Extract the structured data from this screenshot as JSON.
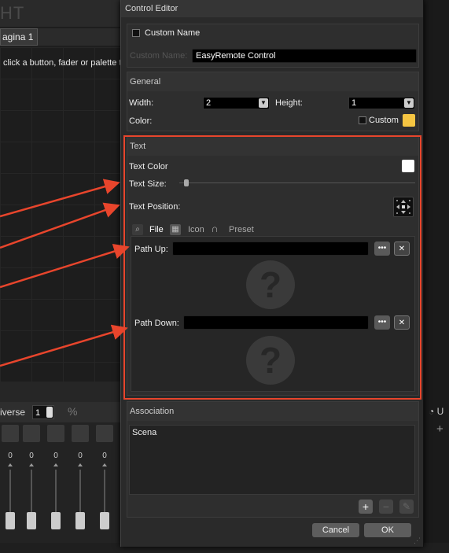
{
  "background": {
    "app_title_fragment": "HT",
    "page_tab": "agina 1",
    "hint_text": "click a button, fader or palette to",
    "universe_label": "iverse",
    "universe_value": "1",
    "fader_values": [
      "0",
      "0",
      "0",
      "0",
      "0",
      "0"
    ],
    "right_u_label": "U",
    "right_plus": "+"
  },
  "dialog": {
    "title": "Control Editor",
    "custom_name": {
      "checkbox_label": "Custom Name",
      "checked": false,
      "field_label": "Custom Name:",
      "field_value": "EasyRemote Control"
    },
    "general": {
      "header": "General",
      "width_label": "Width:",
      "width_value": "2",
      "height_label": "Height:",
      "height_value": "1",
      "color_label": "Color:",
      "custom_label": "Custom",
      "custom_checked": false,
      "custom_color": "#f5c542"
    },
    "text": {
      "header": "Text",
      "text_color_label": "Text Color",
      "text_color": "#ffffff",
      "text_size_label": "Text Size:",
      "text_position_label": "Text Position:",
      "tabs": [
        {
          "label": "File",
          "icon": "search-icon",
          "active": true
        },
        {
          "label": "Icon",
          "icon": "grid-icon",
          "active": false
        },
        {
          "label": "Preset",
          "icon": "magnet-icon",
          "active": false
        }
      ],
      "path_up_label": "Path Up:",
      "path_up_value": "",
      "path_down_label": "Path Down:",
      "path_down_value": "",
      "browse_glyph": "•••",
      "clear_glyph": "✕",
      "placeholder_glyph": "?"
    },
    "association": {
      "header": "Association",
      "items": [
        "Scena"
      ],
      "add_glyph": "+",
      "remove_glyph": "−",
      "edit_glyph": "✎"
    },
    "buttons": {
      "cancel": "Cancel",
      "ok": "OK"
    }
  },
  "annotation": {
    "highlight_color": "#e8452c"
  }
}
